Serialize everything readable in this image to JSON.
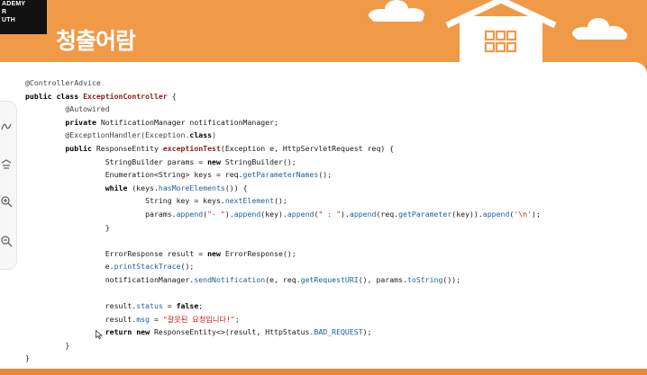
{
  "header": {
    "logo_text": "ADEMY\nR\nUTH",
    "title": "청출어람"
  },
  "colors": {
    "background": "#f09a48",
    "panel": "#ffffff",
    "keyword": "#000000",
    "method": "#1d5e9e",
    "declaration": "#8a1e1e",
    "string": "#d11515"
  },
  "toolbar": {
    "icons": [
      "pen-icon",
      "marker-icon",
      "zoom-in-icon",
      "zoom-out-icon"
    ]
  },
  "code": {
    "l1": "@ControllerAdvice",
    "l2a": "public class ",
    "l2b": "ExceptionController",
    "l2c": " {",
    "l3": "@Autowired",
    "l4a": "private",
    "l4b": " NotificationManager notificationManager;",
    "l5a": "@ExceptionHandler(Exception.",
    "l5b": "class",
    "l5c": ")",
    "l6a": "public",
    "l6b": " ResponseEntity ",
    "l6c": "exceptionTest",
    "l6d": "(Exception e, HttpServletRequest req) {",
    "l7a": "StringBuilder params = ",
    "l7b": "new",
    "l7c": " StringBuilder();",
    "l8a": "Enumeration<String> keys = req.",
    "l8b": "getParameterNames",
    "l8c": "();",
    "l9a": "while",
    "l9b": " (keys.",
    "l9c": "hasMoreElements",
    "l9d": "()) {",
    "l10a": "String key = keys.",
    "l10b": "nextElement",
    "l10c": "();",
    "l11a": "params.",
    "l11b": "append",
    "l11c": "(",
    "l11d": "\"- \"",
    "l11e": ").",
    "l11f": "append",
    "l11g": "(key).",
    "l11h": "append",
    "l11i": "(",
    "l11j": "\" : \"",
    "l11k": ").",
    "l11l": "append",
    "l11m": "(req.",
    "l11n": "getParameter",
    "l11o": "(key)).",
    "l11p": "append",
    "l11q": "(",
    "l11r": "'\\n'",
    "l11s": ");",
    "l12": "}",
    "l13a": "ErrorResponse result = ",
    "l13b": "new",
    "l13c": " ErrorResponse();",
    "l14a": "e.",
    "l14b": "printStackTrace",
    "l14c": "();",
    "l15a": "notificationManager.",
    "l15b": "sendNotification",
    "l15c": "(e, req.",
    "l15d": "getRequestURI",
    "l15e": "(), params.",
    "l15f": "toString",
    "l15g": "());",
    "l16a": "result.",
    "l16b": "status",
    "l16c": " = ",
    "l16d": "false",
    "l16e": ";",
    "l17a": "result.",
    "l17b": "msg",
    "l17c": " = ",
    "l17d": "\"잘못된 요청입니다!\"",
    "l17e": ";",
    "l18a": "return",
    "l18b": " new",
    "l18c": " ResponseEntity<>(result, HttpStatus.",
    "l18d": "BAD_REQUEST",
    "l18e": ");",
    "l19": "}",
    "l20": "}"
  }
}
